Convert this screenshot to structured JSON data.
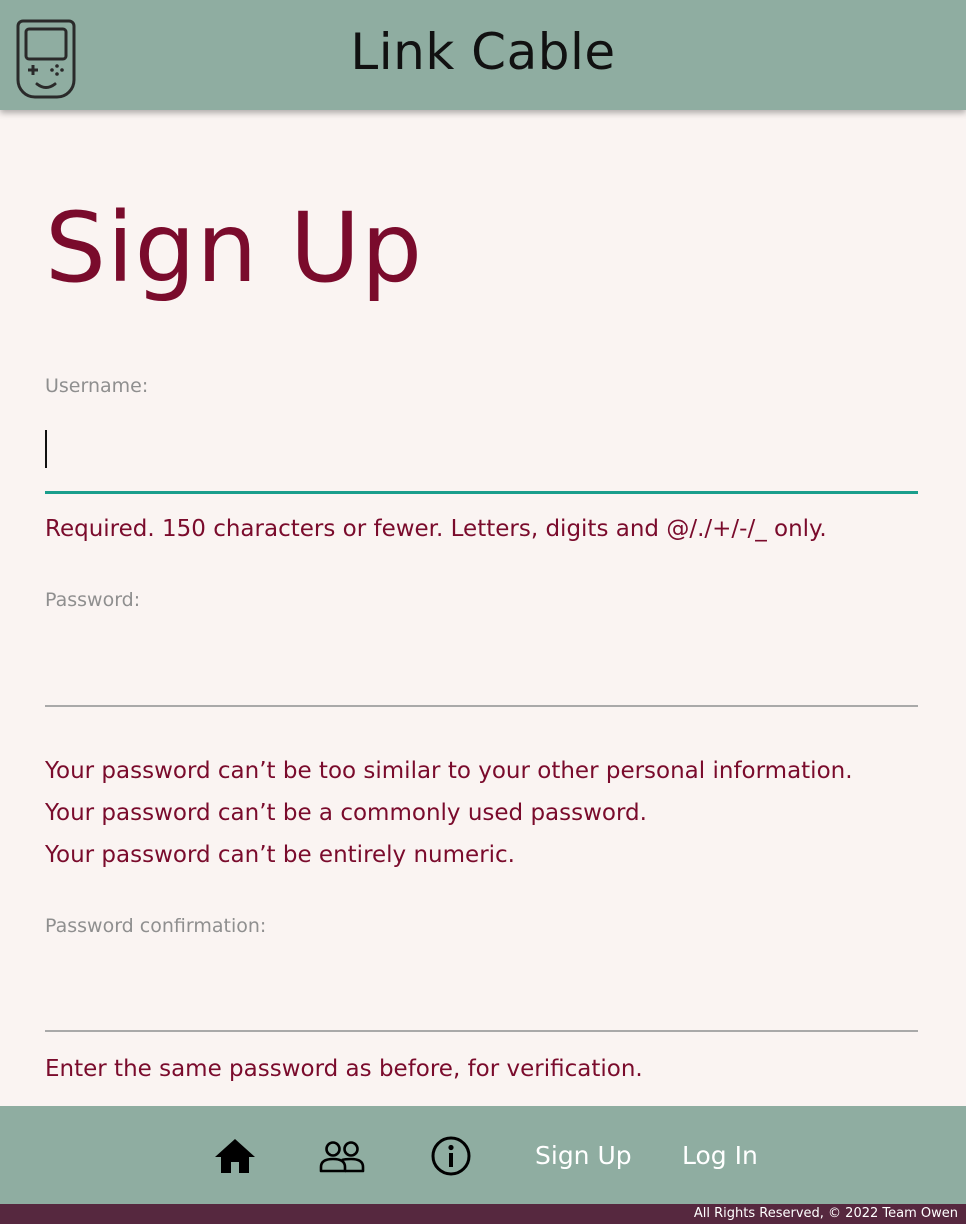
{
  "header": {
    "logo_icon": "gameboy-icon",
    "title": "Link Cable"
  },
  "form": {
    "title": "Sign Up",
    "username": {
      "label": "Username:",
      "value": "",
      "help": "Required. 150 characters or fewer. Letters, digits and @/./+/-/_ only."
    },
    "password": {
      "label": "Password:",
      "value": "",
      "help": [
        "Your password can’t be too similar to your other personal information.",
        "Your password can’t be a commonly used password.",
        "Your password can’t be entirely numeric."
      ]
    },
    "password_confirmation": {
      "label": "Password confirmation:",
      "value": "",
      "help": "Enter the same password as before, for verification."
    }
  },
  "nav": {
    "home_icon": "home-icon",
    "friends_icon": "people-icon",
    "info_icon": "info-icon",
    "signup_label": "Sign Up",
    "login_label": "Log In"
  },
  "footer": {
    "copyright": "All Rights Reserved, © 2022 Team Owen"
  },
  "colors": {
    "header_bg": "#8fada1",
    "page_bg": "#faf4f2",
    "accent_text": "#7a0b2c",
    "focus_underline": "#1a9e8c",
    "footer_bg": "#56283f"
  }
}
